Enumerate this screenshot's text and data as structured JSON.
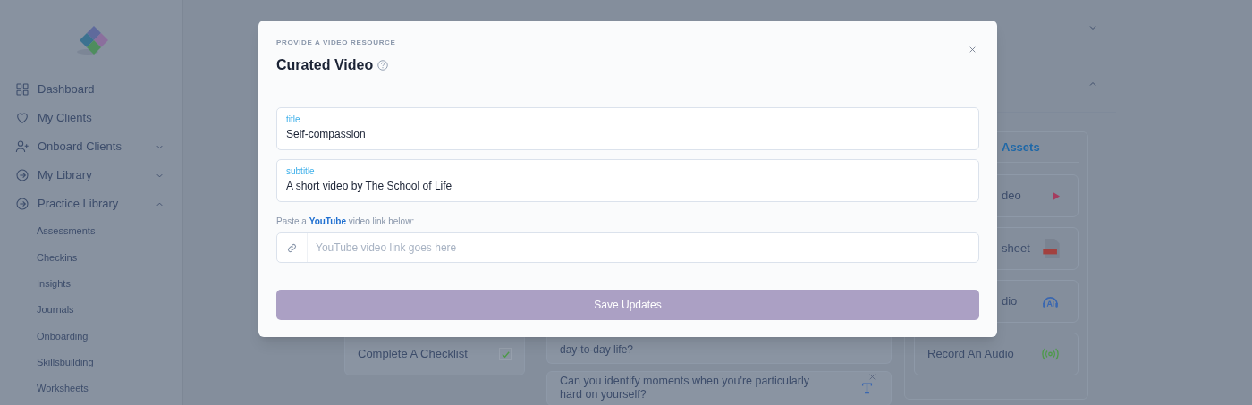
{
  "sidebar": {
    "items": [
      {
        "label": "Dashboard",
        "kind": "link"
      },
      {
        "label": "My Clients",
        "kind": "link"
      },
      {
        "label": "Onboard Clients",
        "kind": "group",
        "expanded": false
      },
      {
        "label": "My Library",
        "kind": "group",
        "expanded": false
      },
      {
        "label": "Practice Library",
        "kind": "group",
        "expanded": true,
        "children": [
          {
            "label": "Assessments"
          },
          {
            "label": "Checkins"
          },
          {
            "label": "Insights"
          },
          {
            "label": "Journals"
          },
          {
            "label": "Onboarding"
          },
          {
            "label": "Skillsbuilding"
          },
          {
            "label": "Worksheets"
          }
        ]
      }
    ]
  },
  "accordions": [
    {
      "expanded": false
    },
    {
      "expanded": true
    }
  ],
  "left_cards": [
    {
      "label": "Complete A Checklist",
      "checked": true
    }
  ],
  "middle_cards": [
    {
      "text": "day-to-day life?",
      "kind": "tail"
    },
    {
      "text": "Can you identify moments when you're particularly hard on yourself?",
      "kind": "question"
    }
  ],
  "assets": {
    "heading": "Assets",
    "items": [
      {
        "label": "deo",
        "kind": "video"
      },
      {
        "label": "sheet",
        "kind": "pdf"
      },
      {
        "label": "dio",
        "kind": "ai-audio"
      },
      {
        "label": "Record An Audio",
        "kind": "record"
      }
    ]
  },
  "modal": {
    "eyebrow": "PROVIDE A VIDEO RESOURCE",
    "title": "Curated Video",
    "fields": [
      {
        "label": "title",
        "value": "Self-compassion"
      },
      {
        "label": "subtitle",
        "value": "A short video by The School of Life"
      }
    ],
    "link_hint": {
      "before": "Paste a",
      "link": "YouTube",
      "after": "video link below:"
    },
    "link_field": {
      "placeholder": "YouTube video link goes here"
    },
    "save": {
      "label": "Save Updates",
      "disabled": true
    }
  }
}
